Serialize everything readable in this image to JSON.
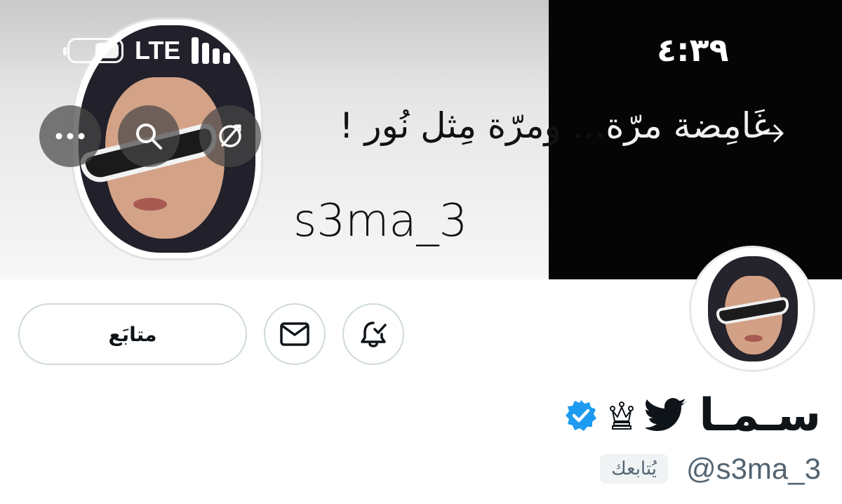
{
  "status_bar": {
    "time": "٤:٣٩",
    "network": "LTE",
    "signal_bars": 4,
    "battery_level": 0.5
  },
  "banner": {
    "text_light_part": "غَامِضة مرّة",
    "text_dark_part": "... ومرّة مِثل نُور !",
    "handle_text": "s3ma_3"
  },
  "header_actions": {
    "more_icon": "more-icon",
    "search_icon": "search-icon",
    "translate_icon": "translate-icon"
  },
  "actions": {
    "follow_label": "متابَع",
    "message_icon": "envelope-icon",
    "notify_icon": "bell-check-icon"
  },
  "profile": {
    "display_name": "سـمـا",
    "handle": "@s3ma_3",
    "follows_you": "يُتابعك",
    "icons": [
      "bird-icon",
      "crown-icon",
      "verified-icon"
    ]
  },
  "colors": {
    "verified_blue": "#1d9bf0",
    "text_secondary": "#536471",
    "border": "#cfd9de"
  }
}
